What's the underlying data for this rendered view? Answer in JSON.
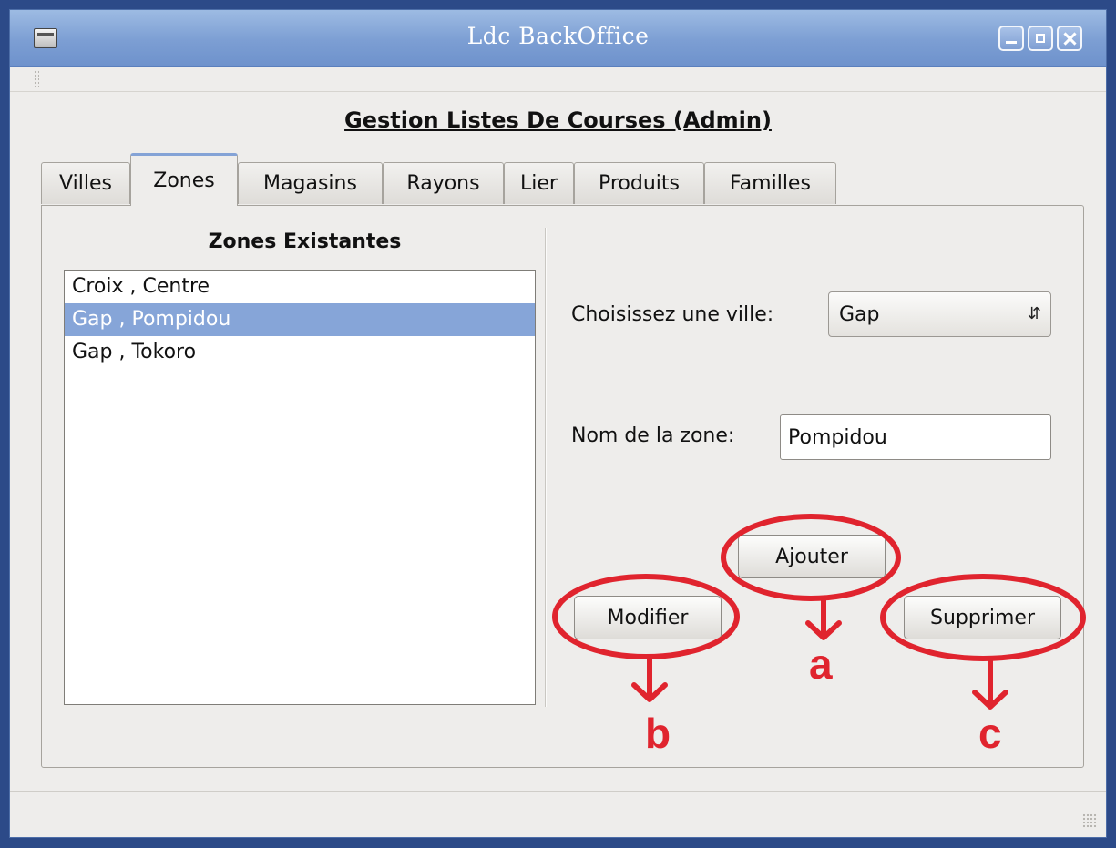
{
  "window": {
    "title": "Ldc BackOffice"
  },
  "page": {
    "title": "Gestion Listes De Courses (Admin)"
  },
  "tabs": [
    {
      "label": "Villes",
      "active": false
    },
    {
      "label": "Zones",
      "active": true
    },
    {
      "label": "Magasins",
      "active": false
    },
    {
      "label": "Rayons",
      "active": false
    },
    {
      "label": "Lier",
      "active": false
    },
    {
      "label": "Produits",
      "active": false
    },
    {
      "label": "Familles",
      "active": false
    }
  ],
  "zones_panel": {
    "list_title": "Zones Existantes",
    "items": [
      {
        "label": "Croix , Centre",
        "selected": false
      },
      {
        "label": "Gap , Pompidou",
        "selected": true
      },
      {
        "label": "Gap , Tokoro",
        "selected": false
      }
    ],
    "city_label": "Choisissez une ville:",
    "city_value": "Gap",
    "zone_name_label": "Nom de la zone:",
    "zone_name_value": "Pompidou",
    "buttons": {
      "add": "Ajouter",
      "modify": "Modifier",
      "delete": "Supprimer"
    }
  },
  "annotations": {
    "color": "#e0242e",
    "labels": {
      "add": "a",
      "modify": "b",
      "delete": "c"
    }
  },
  "colors": {
    "titlebar": "#7c9ed3",
    "selection": "#86a5d8",
    "desktop": "#2c4a88"
  }
}
